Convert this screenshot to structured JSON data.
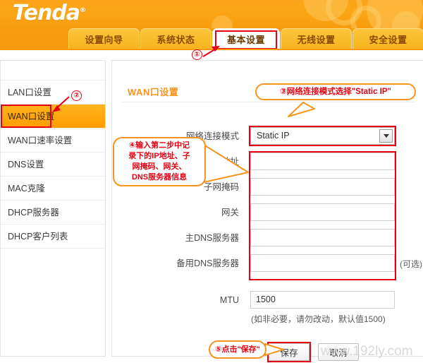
{
  "brand": {
    "name": "Tenda",
    "trademark": "®"
  },
  "tabs": [
    {
      "label": "设置向导",
      "active": false
    },
    {
      "label": "系统状态",
      "active": false
    },
    {
      "label": "基本设置",
      "active": true
    },
    {
      "label": "无线设置",
      "active": false
    },
    {
      "label": "安全设置",
      "active": false
    }
  ],
  "sidebar": {
    "items": [
      {
        "label": "LAN口设置",
        "active": false
      },
      {
        "label": "WAN口设置",
        "active": true
      },
      {
        "label": "WAN口速率设置",
        "active": false
      },
      {
        "label": "DNS设置",
        "active": false
      },
      {
        "label": "MAC克隆",
        "active": false
      },
      {
        "label": "DHCP服务器",
        "active": false
      },
      {
        "label": "DHCP客户列表",
        "active": false
      }
    ]
  },
  "panel": {
    "section_title": "WAN口设置",
    "fields": {
      "mode_label": "网络连接模式",
      "mode_value": "Static IP",
      "ip_label": "IP地址",
      "ip_value": "",
      "mask_label": "子网掩码",
      "mask_value": "",
      "gateway_label": "网关",
      "gateway_value": "",
      "dns1_label": "主DNS服务器",
      "dns1_value": "",
      "dns2_label": "备用DNS服务器",
      "dns2_value": "",
      "dns2_optional": "(可选)",
      "mtu_label": "MTU",
      "mtu_value": "1500",
      "mtu_hint": "(如非必要，请勿改动，默认值1500)"
    },
    "buttons": {
      "save": "保存",
      "cancel": "取消"
    }
  },
  "annotations": {
    "step1": {
      "num": "①"
    },
    "step2": {
      "num": "②"
    },
    "step3": {
      "text": "③网络连接模式选择\"Static IP\""
    },
    "step4": {
      "text": "④输入第二步中记\n录下的IP地址、子\n网掩码、网关、\nDNS服务器信息"
    },
    "step5": {
      "text": "⑤点击\"保存\""
    }
  },
  "watermark": {
    "text": "www.192ly.com"
  },
  "colors": {
    "brand_orange": "#f7941d",
    "header_orange": "#fba21a",
    "tab_yellow": "#fcc43c",
    "highlight_red": "#e60012",
    "active_nav": "#ff9d00"
  }
}
